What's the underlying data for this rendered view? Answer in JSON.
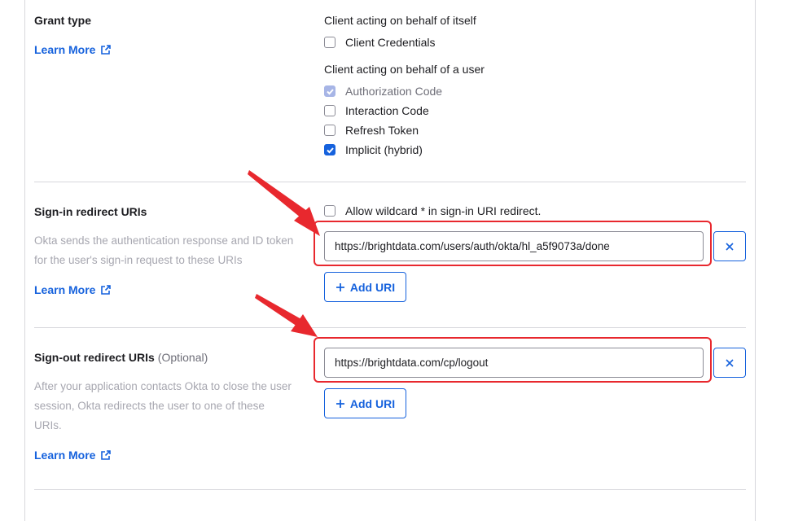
{
  "grant_type": {
    "label": "Grant type",
    "learn_more": "Learn More",
    "self_group_title": "Client acting on behalf of itself",
    "self_options": [
      {
        "label": "Client Credentials",
        "state": "unchecked"
      }
    ],
    "user_group_title": "Client acting on behalf of a user",
    "user_options": [
      {
        "label": "Authorization Code",
        "state": "checked-disabled"
      },
      {
        "label": "Interaction Code",
        "state": "unchecked"
      },
      {
        "label": "Refresh Token",
        "state": "unchecked"
      },
      {
        "label": "Implicit (hybrid)",
        "state": "checked"
      }
    ]
  },
  "sign_in": {
    "label": "Sign-in redirect URIs",
    "description": "Okta sends the authentication response and ID token for the user's sign-in request to these URIs",
    "learn_more": "Learn More",
    "wildcard_label": "Allow wildcard * in sign-in URI redirect.",
    "wildcard_checked": false,
    "uri_value": "https://brightdata.com/users/auth/okta/hl_a5f9073a/done",
    "add_label": "Add URI"
  },
  "sign_out": {
    "label": "Sign-out redirect URIs",
    "optional": "(Optional)",
    "description": "After your application contacts Okta to close the user session, Okta redirects the user to one of these URIs.",
    "learn_more": "Learn More",
    "uri_value": "https://brightdata.com/cp/logout",
    "add_label": "Add URI"
  },
  "icons": {
    "external_link": "external-link-icon",
    "check": "check-icon",
    "close": "close-icon",
    "plus": "plus-icon",
    "annotation_arrow": "arrow-icon"
  },
  "colors": {
    "link": "#1662dd",
    "annotation": "#e8282e",
    "disabled_check": "#a7b5e6"
  }
}
